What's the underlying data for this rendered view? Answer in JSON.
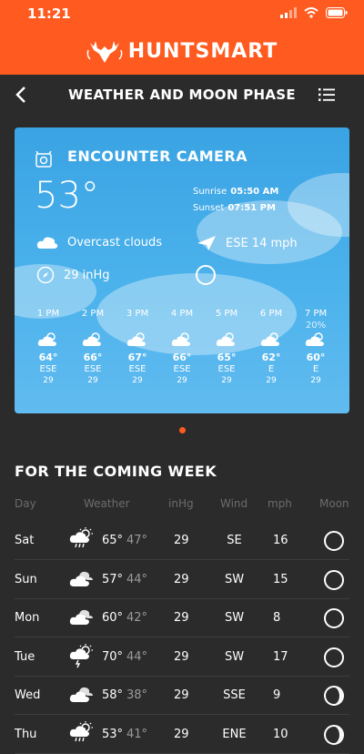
{
  "status": {
    "time": "11:21"
  },
  "brand": {
    "name": "HUNTSMART"
  },
  "nav": {
    "title": "WEATHER AND MOON PHASE"
  },
  "card": {
    "camera_name": "ENCOUNTER CAMERA",
    "temperature": "53°",
    "sunrise_label": "Sunrise",
    "sunrise_value": "05:50 AM",
    "sunset_label": "Sunset",
    "sunset_value": "07:51 PM",
    "condition": "Overcast clouds",
    "wind": "ESE 14 mph",
    "pressure": "29 inHg",
    "hours": [
      {
        "hour": "1 PM",
        "precip": "",
        "temp": "64°",
        "dir": "ESE",
        "val": "29"
      },
      {
        "hour": "2 PM",
        "precip": "",
        "temp": "66°",
        "dir": "ESE",
        "val": "29"
      },
      {
        "hour": "3 PM",
        "precip": "",
        "temp": "67°",
        "dir": "ESE",
        "val": "29"
      },
      {
        "hour": "4 PM",
        "precip": "",
        "temp": "66°",
        "dir": "ESE",
        "val": "29"
      },
      {
        "hour": "5 PM",
        "precip": "",
        "temp": "65°",
        "dir": "ESE",
        "val": "29"
      },
      {
        "hour": "6 PM",
        "precip": "",
        "temp": "62°",
        "dir": "E",
        "val": "29"
      },
      {
        "hour": "7 PM",
        "precip": "20%",
        "temp": "60°",
        "dir": "E",
        "val": "29"
      }
    ]
  },
  "week": {
    "title": "FOR THE COMING WEEK",
    "headers": {
      "day": "Day",
      "weather": "Weather",
      "inhg": "inHg",
      "wind": "Wind",
      "mph": "mph",
      "moon": "Moon"
    },
    "rows": [
      {
        "day": "Sat",
        "icon": "sun-rain-cloud-icon",
        "hi": "65°",
        "lo": "47°",
        "inhg": "29",
        "wind": "SE",
        "mph": "16",
        "moon": "new"
      },
      {
        "day": "Sun",
        "icon": "cloudy-icon",
        "hi": "57°",
        "lo": "44°",
        "inhg": "29",
        "wind": "SW",
        "mph": "15",
        "moon": "new"
      },
      {
        "day": "Mon",
        "icon": "cloudy-icon",
        "hi": "60°",
        "lo": "42°",
        "inhg": "29",
        "wind": "SW",
        "mph": "8",
        "moon": "new"
      },
      {
        "day": "Tue",
        "icon": "sun-storm-cloud-icon",
        "hi": "70°",
        "lo": "44°",
        "inhg": "29",
        "wind": "SW",
        "mph": "17",
        "moon": "new"
      },
      {
        "day": "Wed",
        "icon": "cloudy-icon",
        "hi": "58°",
        "lo": "38°",
        "inhg": "29",
        "wind": "SSE",
        "mph": "9",
        "moon": "crescent"
      },
      {
        "day": "Thu",
        "icon": "sun-rain-cloud-icon",
        "hi": "53°",
        "lo": "41°",
        "inhg": "29",
        "wind": "ENE",
        "mph": "10",
        "moon": "crescent"
      }
    ]
  },
  "colors": {
    "accent": "#ff5a1f",
    "background": "#2b2b2b",
    "card": "#4bb2ec"
  }
}
